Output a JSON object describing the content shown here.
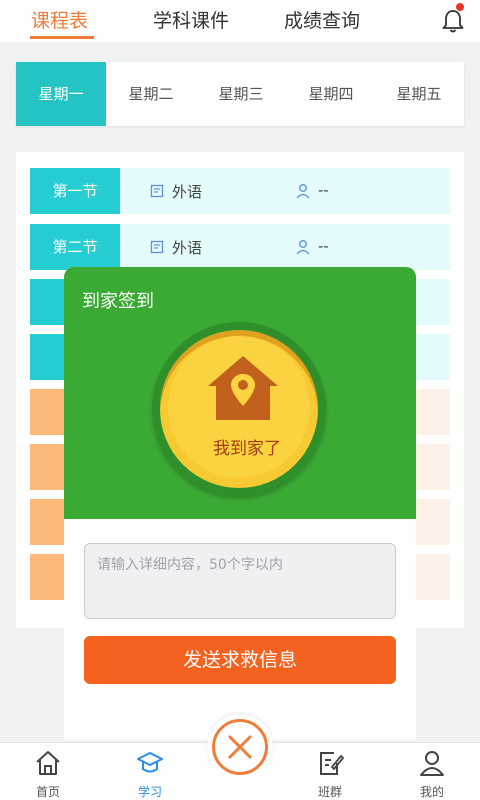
{
  "top_tabs": [
    {
      "label": "课程表",
      "active": true
    },
    {
      "label": "学科课件",
      "active": false
    },
    {
      "label": "成绩查询",
      "active": false
    }
  ],
  "notification_icon": "bell-icon",
  "days": [
    {
      "label": "星期一",
      "active": true
    },
    {
      "label": "星期二",
      "active": false
    },
    {
      "label": "星期三",
      "active": false
    },
    {
      "label": "星期四",
      "active": false
    },
    {
      "label": "星期五",
      "active": false
    }
  ],
  "schedule": [
    {
      "period": "第一节",
      "subject": "外语",
      "teacher": "--"
    },
    {
      "period": "第二节",
      "subject": "外语",
      "teacher": "--"
    }
  ],
  "modal": {
    "title": "到家签到",
    "home_button_label": "我到家了",
    "message_placeholder": "请输入详细内容，50个字以内",
    "sos_button": "发送求救信息"
  },
  "bottom_nav": [
    {
      "label": "首页",
      "icon": "home-icon"
    },
    {
      "label": "学习",
      "icon": "graduation-cap-icon",
      "active": true
    },
    {
      "label": "班群",
      "icon": "edit-icon"
    },
    {
      "label": "我的",
      "icon": "person-icon"
    }
  ],
  "colors": {
    "accent_orange": "#f07c3b",
    "teal": "#26cdd2",
    "green": "#3aaa35",
    "sos": "#f5621f",
    "nav_active": "#2a8ee8"
  }
}
